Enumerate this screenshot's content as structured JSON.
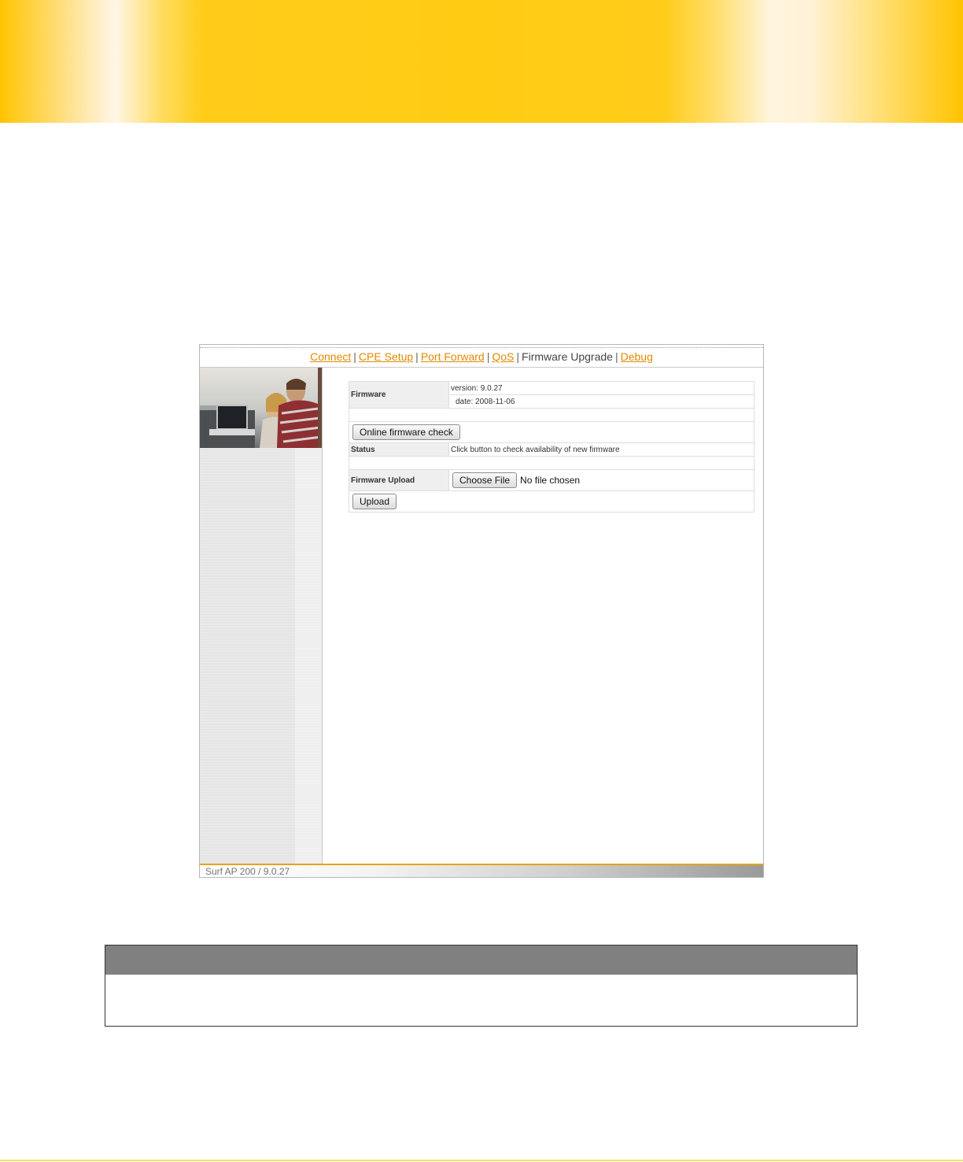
{
  "nav": {
    "items": [
      {
        "label": "Connect",
        "link": true
      },
      {
        "label": "CPE Setup",
        "link": true
      },
      {
        "label": "Port Forward",
        "link": true
      },
      {
        "label": "QoS",
        "link": true
      },
      {
        "label": "Firmware Upgrade",
        "link": false
      },
      {
        "label": "Debug",
        "link": true
      }
    ],
    "separator": "|"
  },
  "firmware": {
    "label": "Firmware",
    "version": "version: 9.0.27",
    "date": "date: 2008-11-06"
  },
  "online_check": {
    "button_label": "Online firmware check"
  },
  "status": {
    "label": "Status",
    "value": "Click button to check availability of new firmware"
  },
  "upload": {
    "label": "Firmware Upload",
    "choose_label": "Choose File",
    "file_status": "No file chosen",
    "button_label": "Upload"
  },
  "footer": {
    "text": "Surf AP 200 / 9.0.27"
  },
  "colors": {
    "banner": "#ffcc14",
    "link": "#e08a00",
    "footer_rule": "#e9a21c",
    "note_header": "#808080"
  }
}
